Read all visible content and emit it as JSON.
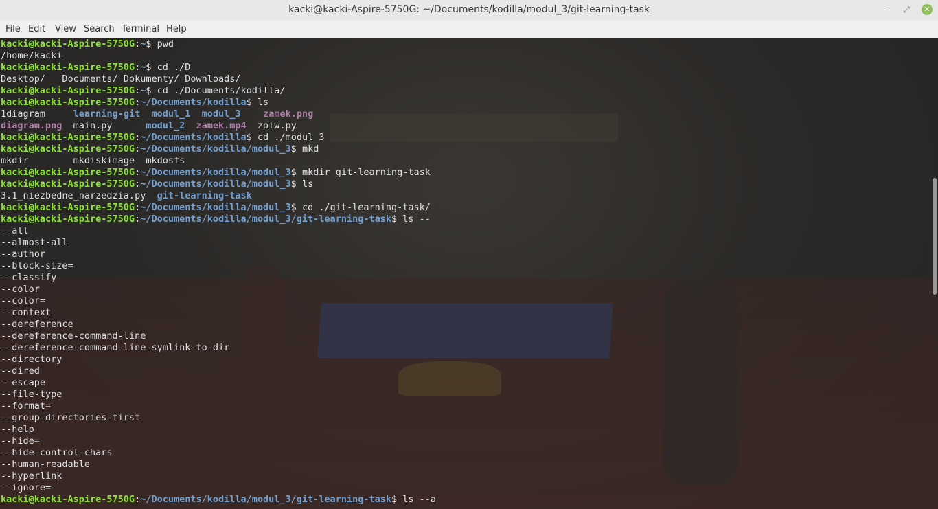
{
  "window": {
    "title": "kacki@kacki-Aspire-5750G: ~/Documents/kodilla/modul_3/git-learning-task",
    "min_glyph": "–",
    "max_glyph": "⤢",
    "close_glyph": "✕"
  },
  "menu": [
    "File",
    "Edit",
    "View",
    "Search",
    "Terminal",
    "Help"
  ],
  "prompt_user": "kacki@kacki-Aspire-5750G",
  "lines": [
    {
      "type": "prompt",
      "path": "~",
      "cmd": " pwd"
    },
    {
      "type": "out",
      "text": "/home/kacki"
    },
    {
      "type": "prompt",
      "path": "~",
      "cmd": " cd ./D"
    },
    {
      "type": "out",
      "text": "Desktop/   Documents/ Dokumenty/ Downloads/"
    },
    {
      "type": "prompt",
      "path": "~",
      "cmd": " cd ./Documents/kodilla/"
    },
    {
      "type": "prompt",
      "path": "~/Documents/kodilla",
      "cmd": " ls"
    },
    {
      "type": "ls",
      "parts": [
        {
          "t": "1diagram     ",
          "c": ""
        },
        {
          "t": "learning-git",
          "c": "d"
        },
        {
          "t": "  ",
          "c": ""
        },
        {
          "t": "modul_1",
          "c": "d"
        },
        {
          "t": "  ",
          "c": ""
        },
        {
          "t": "modul_3",
          "c": "d"
        },
        {
          "t": "    ",
          "c": ""
        },
        {
          "t": "zamek.png",
          "c": "img"
        }
      ]
    },
    {
      "type": "ls",
      "parts": [
        {
          "t": "diagram.png",
          "c": "img"
        },
        {
          "t": "  main.py      ",
          "c": ""
        },
        {
          "t": "modul_2",
          "c": "d"
        },
        {
          "t": "  ",
          "c": ""
        },
        {
          "t": "zamek.mp4",
          "c": "img"
        },
        {
          "t": "  zolw.py",
          "c": ""
        }
      ]
    },
    {
      "type": "prompt",
      "path": "~/Documents/kodilla",
      "cmd": " cd ./modul_3"
    },
    {
      "type": "prompt",
      "path": "~/Documents/kodilla/modul_3",
      "cmd": " mkd"
    },
    {
      "type": "out",
      "text": "mkdir        mkdiskimage  mkdosfs"
    },
    {
      "type": "prompt",
      "path": "~/Documents/kodilla/modul_3",
      "cmd": " mkdir git-learning-task"
    },
    {
      "type": "prompt",
      "path": "~/Documents/kodilla/modul_3",
      "cmd": " ls"
    },
    {
      "type": "ls",
      "parts": [
        {
          "t": "3.1_niezbedne_narzedzia.py  ",
          "c": ""
        },
        {
          "t": "git-learning-task",
          "c": "d"
        }
      ]
    },
    {
      "type": "prompt",
      "path": "~/Documents/kodilla/modul_3",
      "cmd": " cd ./git-learning-task/"
    },
    {
      "type": "prompt",
      "path": "~/Documents/kodilla/modul_3/git-learning-task",
      "cmd": " ls --"
    },
    {
      "type": "out",
      "text": "--all"
    },
    {
      "type": "out",
      "text": "--almost-all"
    },
    {
      "type": "out",
      "text": "--author"
    },
    {
      "type": "out",
      "text": "--block-size="
    },
    {
      "type": "out",
      "text": "--classify"
    },
    {
      "type": "out",
      "text": "--color"
    },
    {
      "type": "out",
      "text": "--color="
    },
    {
      "type": "out",
      "text": "--context"
    },
    {
      "type": "out",
      "text": "--dereference"
    },
    {
      "type": "out",
      "text": "--dereference-command-line"
    },
    {
      "type": "out",
      "text": "--dereference-command-line-symlink-to-dir"
    },
    {
      "type": "out",
      "text": "--directory"
    },
    {
      "type": "out",
      "text": "--dired"
    },
    {
      "type": "out",
      "text": "--escape"
    },
    {
      "type": "out",
      "text": "--file-type"
    },
    {
      "type": "out",
      "text": "--format="
    },
    {
      "type": "out",
      "text": "--group-directories-first"
    },
    {
      "type": "out",
      "text": "--help"
    },
    {
      "type": "out",
      "text": "--hide="
    },
    {
      "type": "out",
      "text": "--hide-control-chars"
    },
    {
      "type": "out",
      "text": "--human-readable"
    },
    {
      "type": "out",
      "text": "--hyperlink"
    },
    {
      "type": "out",
      "text": "--ignore="
    },
    {
      "type": "prompt",
      "path": "~/Documents/kodilla/modul_3/git-learning-task",
      "cmd": " ls --a"
    }
  ],
  "colors": {
    "user": "#8ae234",
    "path": "#729fcf",
    "dir": "#729fcf",
    "image": "#ad7fa8",
    "text": "#e0e0e0"
  }
}
